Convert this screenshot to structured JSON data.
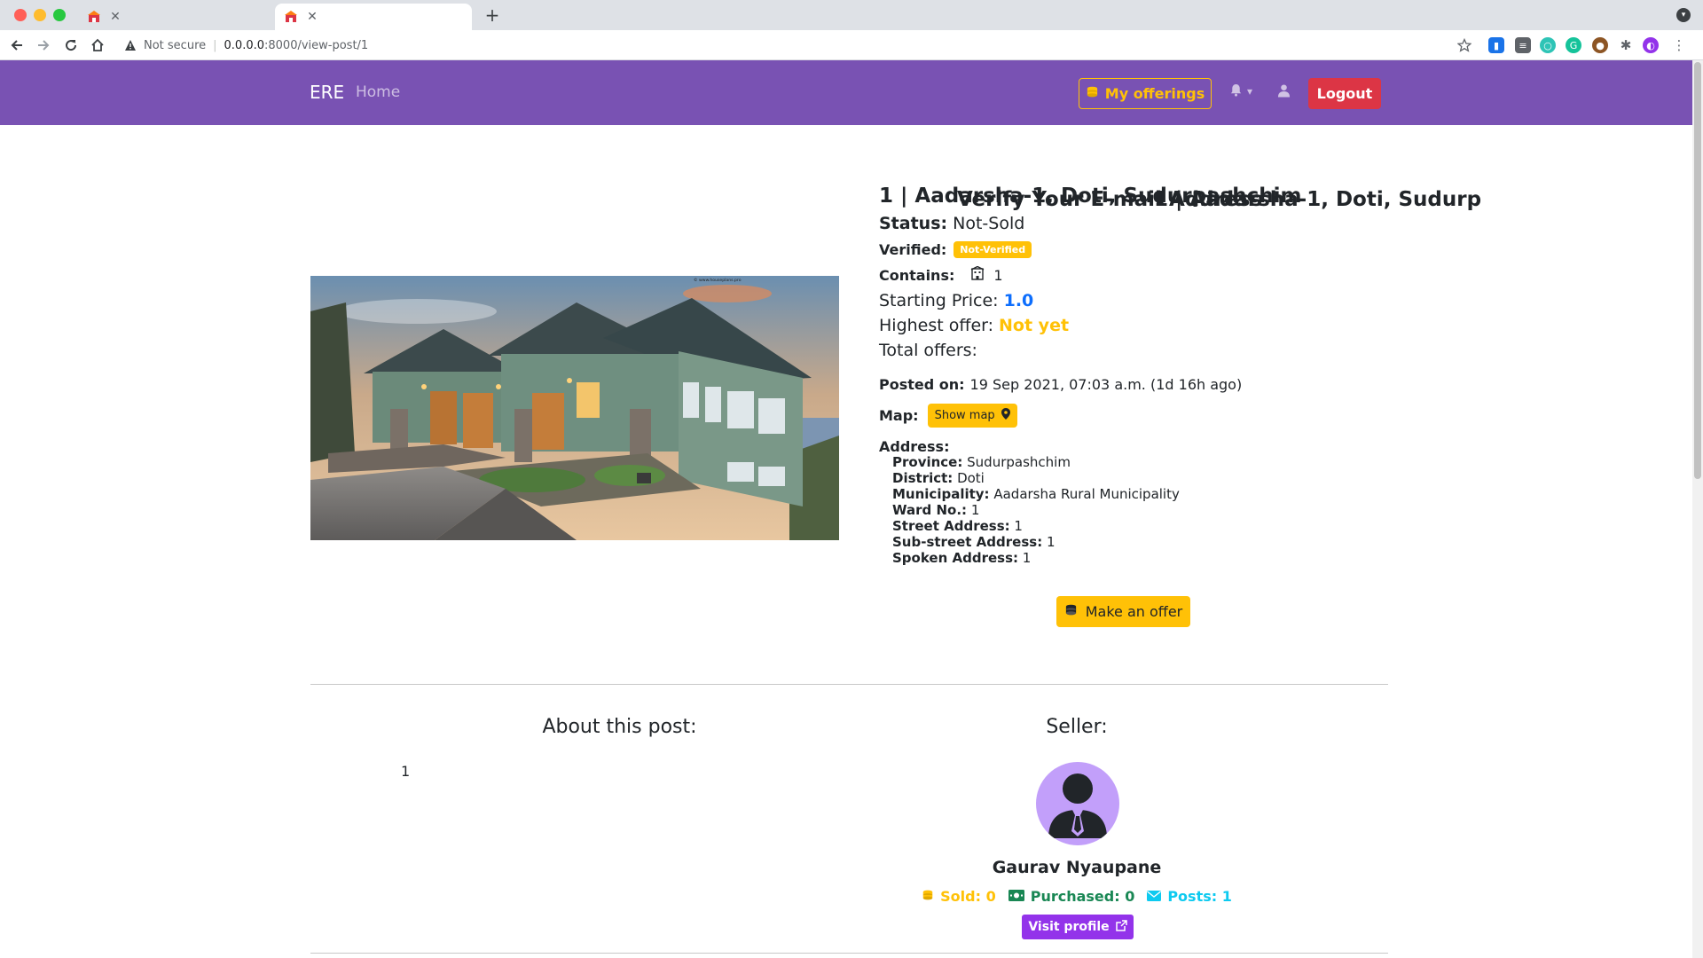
{
  "browser": {
    "tabs": [
      {
        "title": "Verify Your E-mail Address",
        "active": false
      },
      {
        "title": "1 | Aadarsha-1, Doti, Sudurp",
        "active": true
      }
    ],
    "security_label": "Not secure",
    "url_host": "0.0.0.0",
    "url_path": ":8000/view-post/1"
  },
  "navbar": {
    "brand": "ERE",
    "home": "Home",
    "offerings_label": "My offerings",
    "logout_label": "Logout",
    "brand_color": "#7952b3"
  },
  "post": {
    "title": "1 | Aadarsha-1, Doti, Sudurpashchim",
    "status_label": "Status:",
    "status_value": "Not-Sold",
    "verified_label": "Verified:",
    "verified_badge": "Not-Verified",
    "contains_label": "Contains:",
    "contains_value": "1",
    "starting_price_label": "Starting Price:",
    "starting_price_value": "1.0",
    "highest_offer_label": "Highest offer:",
    "highest_offer_value": "Not yet",
    "total_offers_label": "Total offers:",
    "posted_label": "Posted on:",
    "posted_value": "19 Sep 2021, 07:03 a.m. (1d 16h ago)",
    "map_label": "Map:",
    "map_button": "Show map",
    "address_label": "Address:",
    "address": {
      "province_label": "Province:",
      "province": "Sudurpashchim",
      "district_label": "District:",
      "district": "Doti",
      "municipality_label": "Municipality:",
      "municipality": "Aadarsha Rural Municipality",
      "ward_label": "Ward No.:",
      "ward": "1",
      "street_label": "Street Address:",
      "street": "1",
      "substreet_label": "Sub-street Address:",
      "substreet": "1",
      "spoken_label": "Spoken Address:",
      "spoken": "1"
    },
    "offer_button": "Make an offer",
    "image_watermark": "© www.houseplans.pro"
  },
  "about": {
    "heading": "About this post:",
    "body": "1"
  },
  "seller": {
    "heading": "Seller:",
    "name": "Gaurav Nyaupane",
    "sold_label": "Sold: 0",
    "purchased_label": "Purchased: 0",
    "posts_label": "Posts: 1",
    "visit_button": "Visit profile"
  },
  "colors": {
    "warning": "#ffc107",
    "danger": "#dc3545",
    "primary": "#0d6efd",
    "success": "#198754",
    "info": "#0dcaf0",
    "purple": "#9333ea"
  }
}
